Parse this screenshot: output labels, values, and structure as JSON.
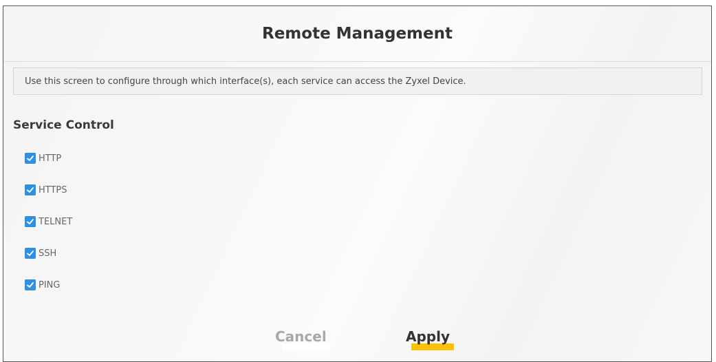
{
  "page": {
    "title": "Remote Management",
    "description": "Use this screen to configure through which interface(s), each service can access the Zyxel Device."
  },
  "service_control": {
    "title": "Service Control",
    "services": [
      {
        "label": "HTTP",
        "checked": true
      },
      {
        "label": "HTTPS",
        "checked": true
      },
      {
        "label": "TELNET",
        "checked": true
      },
      {
        "label": "SSH",
        "checked": true
      },
      {
        "label": "PING",
        "checked": true
      }
    ]
  },
  "actions": {
    "cancel_label": "Cancel",
    "apply_label": "Apply"
  },
  "colors": {
    "checkbox": "#2f8fe0",
    "apply_underline": "#ffc107"
  }
}
